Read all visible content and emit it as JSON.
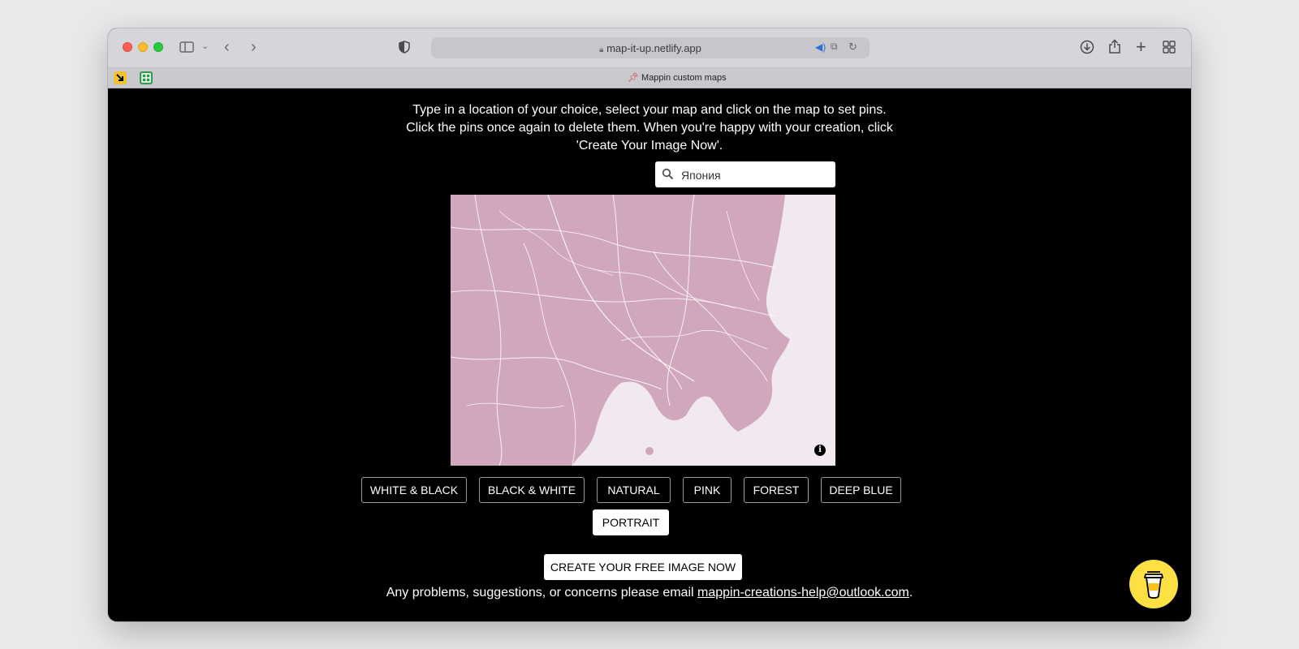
{
  "browser": {
    "url": "map-it-up.netlify.app",
    "tab_title": "Mappin custom maps",
    "tab_favicon": "pushpin"
  },
  "page": {
    "intro": "Type in a location of your choice, select your map and click on the map to set pins. Click the pins once again to delete them. When you're happy with your creation, click 'Create Your Image Now'.",
    "search": {
      "value": "Япония",
      "placeholder": "Япония"
    },
    "map": {
      "info_label": "i",
      "land_color": "#d1a7bd",
      "water_color": "#f1e9ef",
      "road_color": "#ffffff"
    },
    "styles": [
      {
        "label": "WHITE & BLACK",
        "active": false
      },
      {
        "label": "BLACK & WHITE",
        "active": false
      },
      {
        "label": "NATURAL",
        "active": false
      },
      {
        "label": "PINK",
        "active": false
      },
      {
        "label": "FOREST",
        "active": false
      },
      {
        "label": "DEEP BLUE",
        "active": false
      },
      {
        "label": "PORTRAIT",
        "active": true
      }
    ],
    "create_label": "CREATE YOUR FREE IMAGE NOW",
    "footer_text": "Any problems, suggestions, or concerns please email",
    "footer_email": "mappin-creations-help@outlook.com",
    "footer_end": "."
  }
}
